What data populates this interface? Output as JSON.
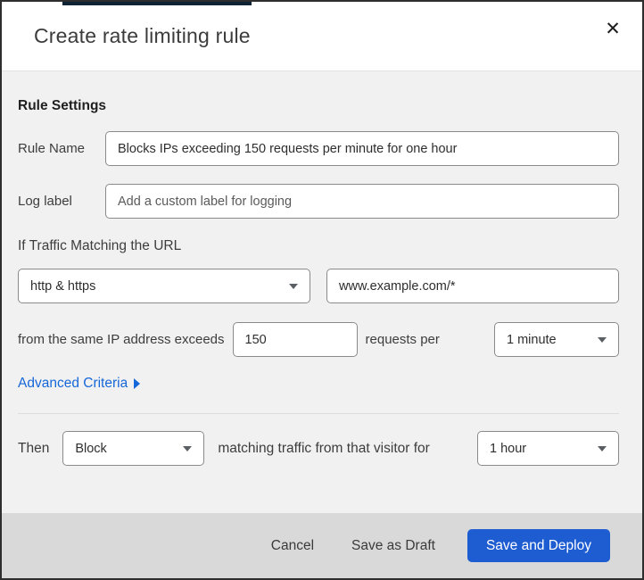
{
  "dialog": {
    "title": "Create rate limiting rule"
  },
  "icons": {
    "close": "✕",
    "chevron_down": "chevron-down",
    "expand_right": "triangle-right"
  },
  "rule_settings": {
    "heading": "Rule Settings",
    "rule_name": {
      "label": "Rule Name",
      "value": "Blocks IPs exceeding 150 requests per minute for one hour"
    },
    "log_label": {
      "label": "Log label",
      "placeholder": "Add a custom label for logging"
    }
  },
  "conditions": {
    "heading": "If Traffic Matching the URL",
    "scheme_select": {
      "value": "http & https"
    },
    "url_input": {
      "value": "www.example.com/*"
    },
    "threshold": {
      "prefix": "from the same IP address exceeds",
      "count": "150",
      "unit_text": "requests per",
      "period_select": {
        "value": "1 minute"
      }
    },
    "advanced_criteria": {
      "label": "Advanced Criteria"
    }
  },
  "action": {
    "prefix": "Then",
    "action_select": {
      "value": "Block"
    },
    "middle": "matching traffic from that visitor for",
    "duration_select": {
      "value": "1 hour"
    }
  },
  "footer": {
    "cancel_label": "Cancel",
    "save_draft_label": "Save as Draft",
    "save_deploy_label": "Save and Deploy"
  },
  "colors": {
    "primary_button": "#1d5cd1",
    "link_blue": "#1667d9",
    "body_bg": "#f1f1f1",
    "footer_bg": "#d9d9d9",
    "page_edge": "#0d2233"
  }
}
